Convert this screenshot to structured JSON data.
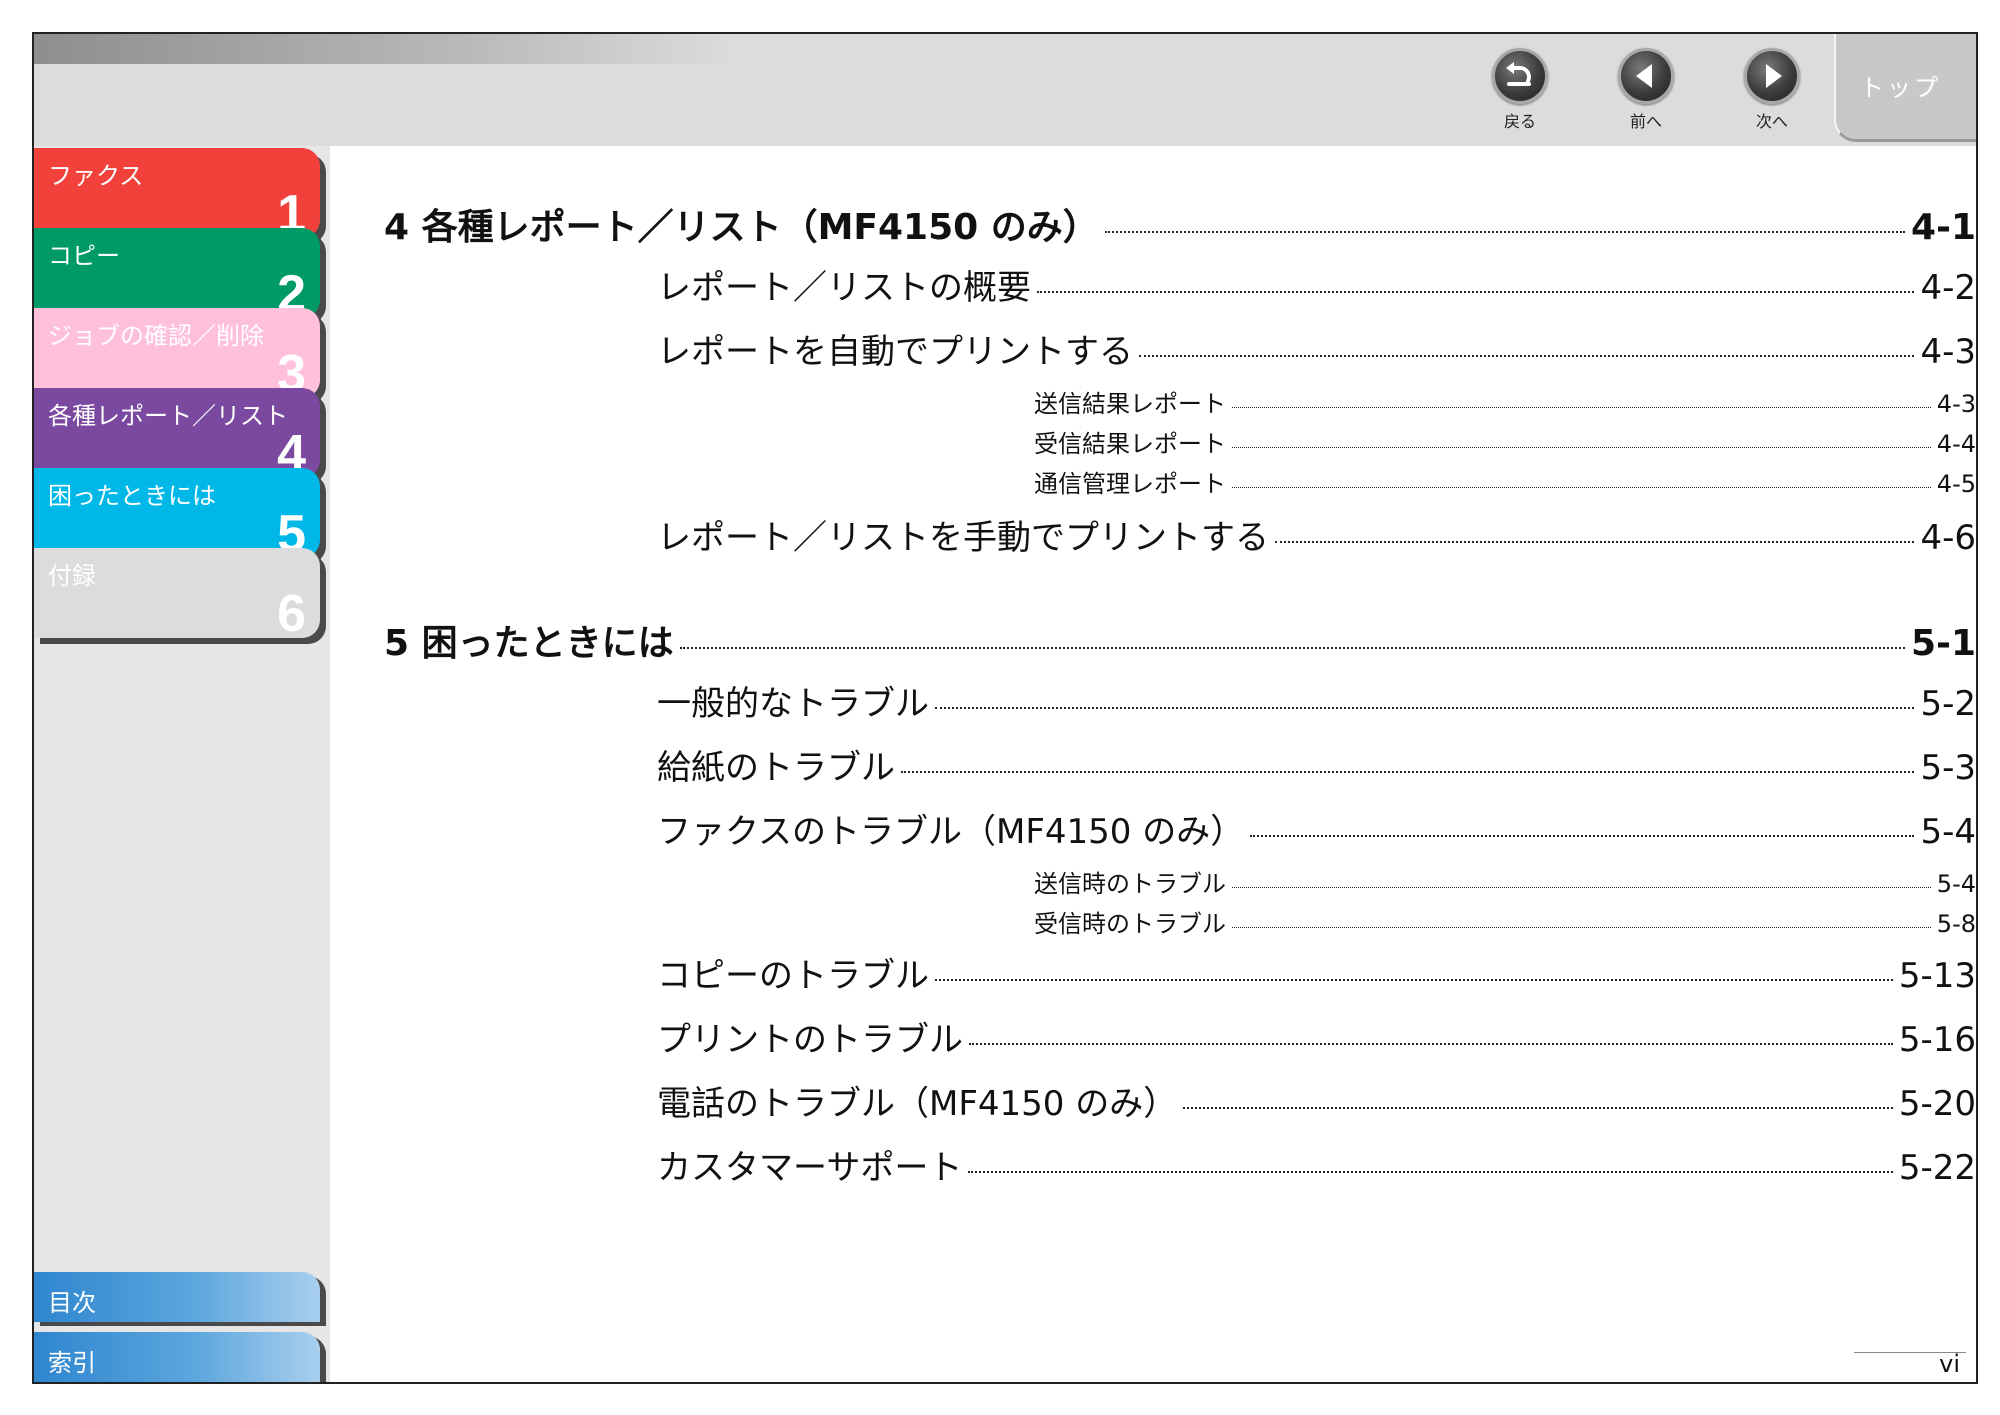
{
  "nav": {
    "back_label": "戻る",
    "prev_label": "前へ",
    "next_label": "次へ",
    "top_label": "トップ"
  },
  "sidebar": {
    "chapters": [
      {
        "label": "ファクス",
        "number": "1",
        "color": "#f2413a"
      },
      {
        "label": "コピー",
        "number": "2",
        "color": "#009a66"
      },
      {
        "label": "ジョブの確認／削除",
        "number": "3",
        "color": "#ffc0dc"
      },
      {
        "label": "各種レポート／リスト",
        "number": "4",
        "color": "#7b4aa0"
      },
      {
        "label": "困ったときには",
        "number": "5",
        "color": "#00b8e8"
      },
      {
        "label": "付録",
        "number": "6",
        "color": "#dcdcdc"
      }
    ],
    "contents_label": "目次",
    "index_label": "索引"
  },
  "toc": [
    {
      "level": 1,
      "title": "4 各種レポート／リスト（MF4150 のみ）",
      "page": "4-1"
    },
    {
      "level": 2,
      "title": "レポート／リストの概要",
      "page": "4-2"
    },
    {
      "level": 2,
      "title": "レポートを自動でプリントする",
      "page": "4-3"
    },
    {
      "level": 3,
      "title": "送信結果レポート",
      "page": "4-3"
    },
    {
      "level": 3,
      "title": "受信結果レポート",
      "page": "4-4"
    },
    {
      "level": 3,
      "title": "通信管理レポート",
      "page": "4-5"
    },
    {
      "level": 2,
      "title": "レポート／リストを手動でプリントする",
      "page": "4-6"
    },
    {
      "level": 1,
      "title": "5 困ったときには",
      "page": "5-1"
    },
    {
      "level": 2,
      "title": "一般的なトラブル",
      "page": "5-2"
    },
    {
      "level": 2,
      "title": "給紙のトラブル",
      "page": "5-3"
    },
    {
      "level": 2,
      "title": "ファクスのトラブル（MF4150 のみ）",
      "page": "5-4"
    },
    {
      "level": 3,
      "title": "送信時のトラブル",
      "page": "5-4"
    },
    {
      "level": 3,
      "title": "受信時のトラブル",
      "page": "5-8"
    },
    {
      "level": 2,
      "title": "コピーのトラブル",
      "page": "5-13"
    },
    {
      "level": 2,
      "title": "プリントのトラブル",
      "page": "5-16"
    },
    {
      "level": 2,
      "title": "電話のトラブル（MF4150 のみ）",
      "page": "5-20"
    },
    {
      "level": 2,
      "title": "カスタマーサポート",
      "page": "5-22"
    }
  ],
  "page_number": "vi"
}
